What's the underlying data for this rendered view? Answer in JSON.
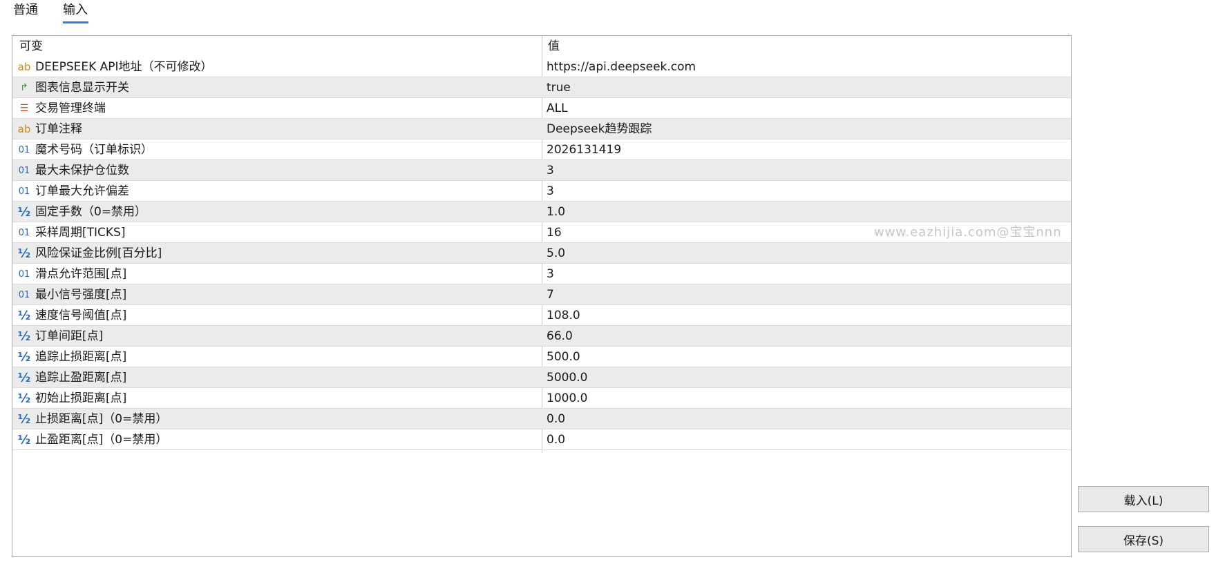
{
  "tabs": [
    {
      "label": "普通"
    },
    {
      "label": "输入"
    }
  ],
  "grid": {
    "header": {
      "variable": "可变",
      "value": "值"
    },
    "rows": [
      {
        "type": "ab",
        "name": "DEEPSEEK API地址（不可修改）",
        "value": "https://api.deepseek.com"
      },
      {
        "type": "bool",
        "name": "图表信息显示开关",
        "value": "true"
      },
      {
        "type": "enum",
        "name": "交易管理终端",
        "value": "ALL"
      },
      {
        "type": "ab",
        "name": "订单注释",
        "value": "Deepseek趋势跟踪"
      },
      {
        "type": "int",
        "name": "魔术号码（订单标识）",
        "value": "2026131419"
      },
      {
        "type": "int",
        "name": "最大未保护仓位数",
        "value": "3"
      },
      {
        "type": "int",
        "name": "订单最大允许偏差",
        "value": "3"
      },
      {
        "type": "double",
        "name": "固定手数（0=禁用）",
        "value": "1.0"
      },
      {
        "type": "int",
        "name": "采样周期[TICKS]",
        "value": "16"
      },
      {
        "type": "double",
        "name": "风险保证金比例[百分比]",
        "value": "5.0"
      },
      {
        "type": "int",
        "name": "滑点允许范围[点]",
        "value": "3"
      },
      {
        "type": "int",
        "name": "最小信号强度[点]",
        "value": "7"
      },
      {
        "type": "double",
        "name": "速度信号阈值[点]",
        "value": "108.0"
      },
      {
        "type": "double",
        "name": "订单间距[点]",
        "value": "66.0"
      },
      {
        "type": "double",
        "name": "追踪止损距离[点]",
        "value": "500.0"
      },
      {
        "type": "double",
        "name": "追踪止盈距离[点]",
        "value": "5000.0"
      },
      {
        "type": "double",
        "name": "初始止损距离[点]",
        "value": "1000.0"
      },
      {
        "type": "double",
        "name": "止损距离[点]（0=禁用）",
        "value": "0.0"
      },
      {
        "type": "double",
        "name": "止盈距离[点]（0=禁用）",
        "value": "0.0"
      }
    ]
  },
  "icons": {
    "ab": {
      "glyph": "ab",
      "name": "string-type-icon"
    },
    "bool": {
      "glyph": "↱",
      "name": "bool-type-icon"
    },
    "enum": {
      "glyph": "☰",
      "name": "enum-type-icon"
    },
    "int": {
      "glyph": "01",
      "name": "integer-type-icon"
    },
    "double": {
      "glyph": "½",
      "name": "double-type-icon"
    }
  },
  "watermark": "www.eazhijia.com@宝宝nnn",
  "buttons": {
    "load": "载入(L)",
    "save": "保存(S)"
  }
}
